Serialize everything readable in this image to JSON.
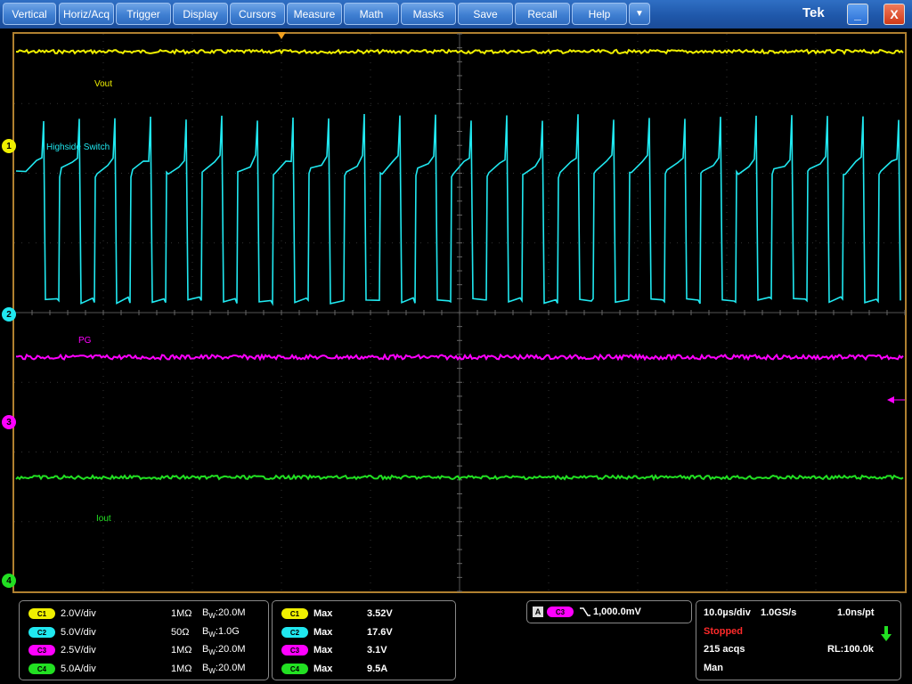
{
  "menu": {
    "items": [
      "Vertical",
      "Horiz/Acq",
      "Trigger",
      "Display",
      "Cursors",
      "Measure",
      "Math",
      "Masks",
      "Save",
      "Recall",
      "Help"
    ],
    "more_icon": "triangle-down-icon",
    "brand": "Tek",
    "minimize_label": "_",
    "close_label": "X"
  },
  "waveforms": {
    "ch1_label": "Vout",
    "ch2_label": "Highside Switch",
    "ch3_label": "PG",
    "ch4_label": "Iout"
  },
  "markers": {
    "ch1": "1",
    "ch2": "2",
    "ch3": "3",
    "ch4": "4"
  },
  "colors": {
    "ch1": "#f0f000",
    "ch2": "#20e8f0",
    "ch3": "#ff00ff",
    "ch4": "#22e022",
    "frame": "#b08030"
  },
  "channels": [
    {
      "tag": "C1",
      "scale": "2.0V/div",
      "coupling": "1MΩ",
      "bw_b": "B",
      "bw_w": "W",
      "bw_val": ":20.0M"
    },
    {
      "tag": "C2",
      "scale": "5.0V/div",
      "coupling": "50Ω",
      "bw_b": "B",
      "bw_w": "W",
      "bw_val": ":1.0G"
    },
    {
      "tag": "C3",
      "scale": "2.5V/div",
      "coupling": "1MΩ",
      "bw_b": "B",
      "bw_w": "W",
      "bw_val": ":20.0M"
    },
    {
      "tag": "C4",
      "scale": "5.0A/div",
      "coupling": "1MΩ",
      "bw_b": "B",
      "bw_w": "W",
      "bw_val": ":20.0M"
    }
  ],
  "measurements": [
    {
      "tag": "C1",
      "type": "Max",
      "value": "3.52V"
    },
    {
      "tag": "C2",
      "type": "Max",
      "value": "17.6V"
    },
    {
      "tag": "C3",
      "type": "Max",
      "value": "3.1V"
    },
    {
      "tag": "C4",
      "type": "Max",
      "value": "9.5A"
    }
  ],
  "trigger": {
    "mode": "A",
    "source": "C3",
    "level": "1,000.0mV",
    "slope_icon": "falling-edge-icon"
  },
  "acquisition": {
    "timebase": "10.0µs/div",
    "sample_rate": "1.0GS/s",
    "resolution": "1.0ns/pt",
    "state": "Stopped",
    "acqs": "215 acqs",
    "record_length": "RL:100.0k",
    "mode": "Man",
    "arrow_icon": "green-down-arrow-icon"
  }
}
